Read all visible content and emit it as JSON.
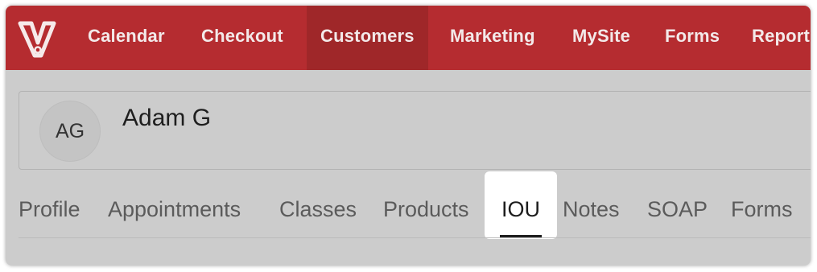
{
  "top_nav": {
    "logo_icon": "vagaro-v-logo-icon",
    "items": [
      {
        "label": "Calendar"
      },
      {
        "label": "Checkout"
      },
      {
        "label": "Customers",
        "active": true
      },
      {
        "label": "Marketing"
      },
      {
        "label": "MySite"
      },
      {
        "label": "Forms"
      },
      {
        "label": "Reports"
      }
    ],
    "colors": {
      "background": "#b52c30",
      "active_background": "#9f2729"
    }
  },
  "customer": {
    "initials": "AG",
    "name": "Adam G"
  },
  "tabs": {
    "items": [
      {
        "label": "Profile"
      },
      {
        "label": "Appointments"
      },
      {
        "label": "Classes"
      },
      {
        "label": "Products"
      },
      {
        "label": "IOU",
        "active": true
      },
      {
        "label": "Notes"
      },
      {
        "label": "SOAP"
      },
      {
        "label": "Forms"
      }
    ]
  }
}
